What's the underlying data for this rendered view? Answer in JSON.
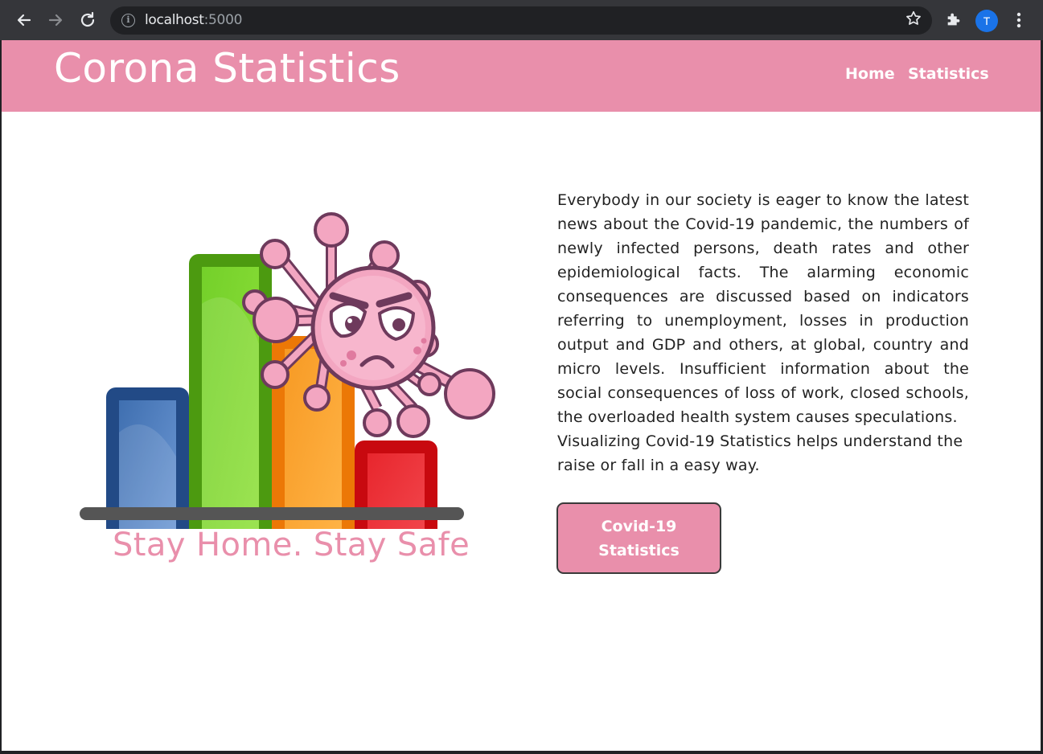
{
  "browser": {
    "url_host": "localhost",
    "url_port": ":5000",
    "profile_initial": "T",
    "icons": [
      "back-arrow-icon",
      "forward-arrow-icon",
      "reload-icon",
      "info-icon",
      "star-icon",
      "extensions-puzzle-icon",
      "kebab-menu-icon"
    ]
  },
  "header": {
    "brand": "Corona Statistics",
    "nav": {
      "home": "Home",
      "statistics": "Statistics"
    }
  },
  "hero": {
    "tagline": "Stay Home. Stay Safe",
    "paragraph_1": "Everybody in our society is eager to know the latest news about the Covid-19 pandemic, the numbers of newly infected persons, death rates and other epidemiological facts. The alarming economic consequences are discussed based on indicators referring to unemployment, losses in production output and GDP and others, at global, country and micro levels. Insufficient information about the social consequences of loss of work, closed schools, the overloaded health system causes speculations.",
    "paragraph_2": "Visualizing Covid-19 Statistics helps understand the raise or fall in a easy way.",
    "button_line_1": "Covid-19",
    "button_line_2": "Statistics"
  },
  "colors": {
    "brand_pink": "#e98fab",
    "bar_blue": "#2d5b9a",
    "bar_green": "#5aaa1c",
    "bar_orange": "#f58a12",
    "bar_red": "#e0232b",
    "virus_pink": "#f3a6c1",
    "virus_outline": "#6e3a5c"
  }
}
